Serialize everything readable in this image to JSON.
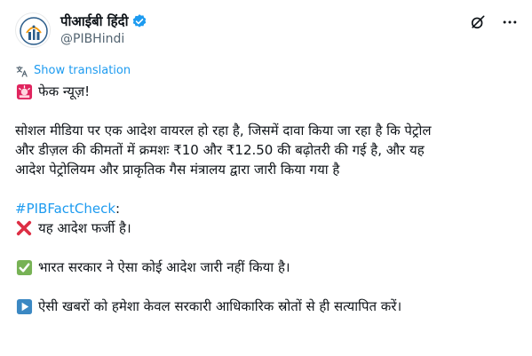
{
  "account": {
    "display_name": "पीआईबी हिंदी",
    "handle": "@PIBHindi",
    "verified_color": "#1d9bf0"
  },
  "actions": {
    "grok_icon": "grok-icon",
    "more_icon": "more-icon"
  },
  "translate": {
    "label": "Show translation"
  },
  "tweet": {
    "line1": "फेक न्यूज़!",
    "paragraph1_line1": "सोशल मीडिया पर एक आदेश वायरल हो रहा है, जिसमें दावा किया जा रहा है कि पेट्रोल",
    "paragraph1_line2": "और डीज़ल की कीमतों में क्रमशः ₹10 और ₹12.50 की बढ़ोतरी की गई है, और यह",
    "paragraph1_line3": "आदेश पेट्रोलियम और प्राकृतिक गैस मंत्रालय द्वारा जारी किया गया है",
    "hashtag": "#PIBFactCheck",
    "hashtag_suffix": ":",
    "claim_false": "यह आदेश फर्जी है।",
    "gov_statement": "भारत सरकार ने ऐसा कोई आदेश जारी नहीं किया है।",
    "advice": "ऐसी खबरों को हमेशा केवल सरकारी आधिकारिक स्रोतों से ही सत्यापित करें।"
  },
  "colors": {
    "link": "#1d9bf0",
    "siren": "#e0245e",
    "cross": "#dd2e44",
    "check": "#77b255",
    "play": "#3b88c3"
  }
}
